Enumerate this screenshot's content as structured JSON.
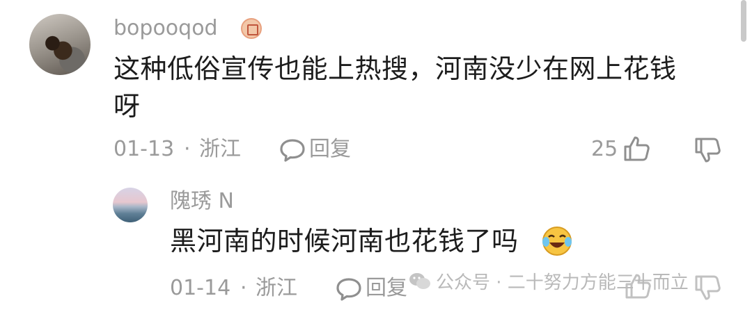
{
  "comment": {
    "username": "bopooqod",
    "badge_icon": "fan-badge-icon",
    "text_line1": "这种低俗宣传也能上热搜，河南没少在网上花钱",
    "text_line2": "呀",
    "date": "01-13",
    "separator": "·",
    "location": "浙江",
    "reply_label": "回复",
    "like_count": "25"
  },
  "reply": {
    "username": "隗琇 N",
    "text": "黑河南的时候河南也花钱了吗",
    "emoji": "crying-laughing-emoji",
    "date": "01-14",
    "separator": "·",
    "location": "浙江",
    "reply_label": "回复"
  },
  "watermark": {
    "text": "公众号 · 二十努力方能三十而立"
  }
}
